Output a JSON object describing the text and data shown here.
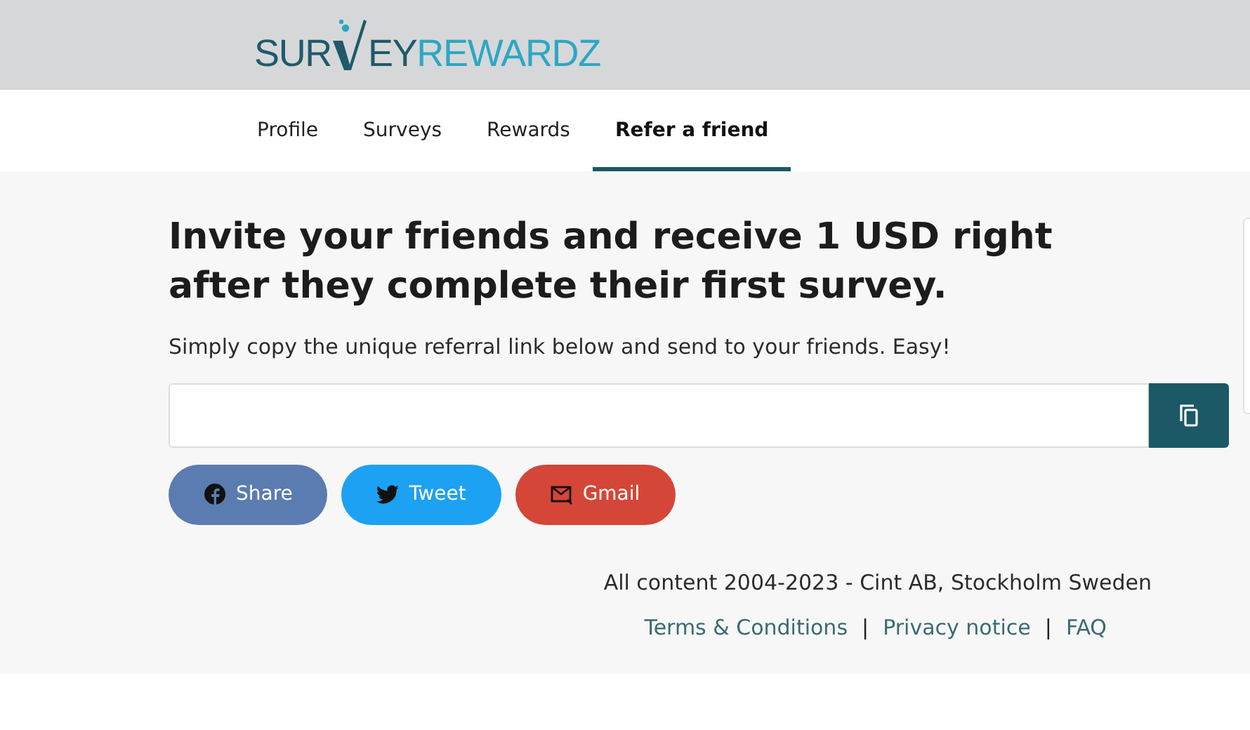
{
  "logo": {
    "dark_start": "SUR",
    "dark_end": "EY",
    "light": "REWARDZ"
  },
  "tabs": [
    {
      "label": "Profile",
      "selected": false
    },
    {
      "label": "Surveys",
      "selected": false
    },
    {
      "label": "Rewards",
      "selected": false
    },
    {
      "label": "Refer a friend",
      "selected": true
    }
  ],
  "heading": "Invite your friends and receive 1 USD right after they complete their first survey.",
  "description": "Simply copy the unique referral link below and send to your friends. Easy!",
  "share_buttons": [
    {
      "kind": "facebook",
      "label": "Share"
    },
    {
      "kind": "twitter",
      "label": "Tweet"
    },
    {
      "kind": "gmail",
      "label": "Gmail"
    }
  ],
  "footer": {
    "copyright": "All content 2004-2023 - Cint AB, Stockholm Sweden",
    "links": [
      "Terms & Conditions",
      "Privacy notice",
      "FAQ"
    ],
    "separator": "|"
  }
}
